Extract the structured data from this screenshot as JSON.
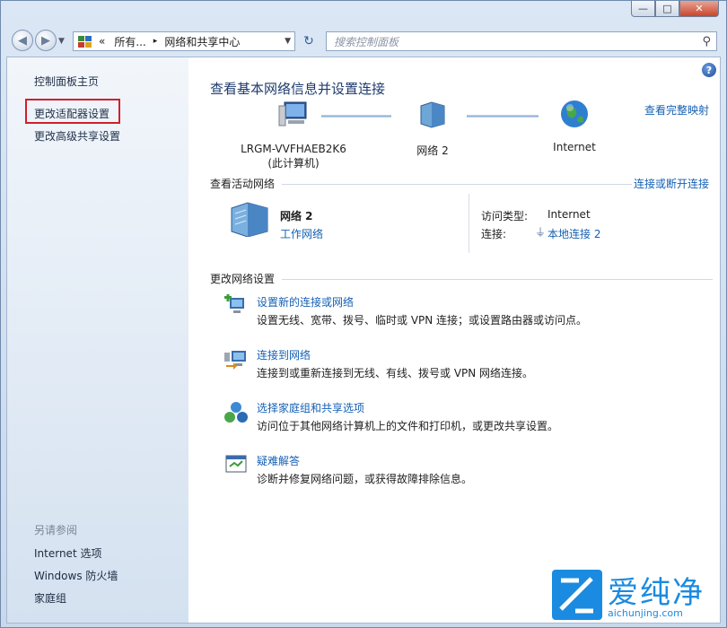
{
  "window": {
    "minimize": "—",
    "maximize": "□",
    "close": "✕"
  },
  "address_bar": {
    "chevron": "«",
    "crumb_1": "所有...",
    "separator": "▸",
    "crumb_2": "网络和共享中心",
    "search_placeholder": "搜索控制面板"
  },
  "sidebar": {
    "home": "控制面板主页",
    "adapter": "更改适配器设置",
    "sharing": "更改高级共享设置",
    "see_also_heading": "另请参阅",
    "see_also": [
      "Internet 选项",
      "Windows 防火墙",
      "家庭组"
    ]
  },
  "main": {
    "title": "查看基本网络信息并设置连接",
    "full_map": "查看完整映射",
    "map_nodes": [
      {
        "name": "LRGM-VVFHAEB2K6",
        "sub": "(此计算机)"
      },
      {
        "name": "网络  2",
        "sub": ""
      },
      {
        "name": "Internet",
        "sub": ""
      }
    ],
    "active_heading": "查看活动网络",
    "connect_disconnect": "连接或断开连接",
    "network_name": "网络  2",
    "network_type": "工作网络",
    "access_type_label": "访问类型:",
    "access_type_value": "Internet",
    "connections_label": "连接:",
    "connections_value": "本地连接 2",
    "change_heading": "更改网络设置",
    "tasks": [
      {
        "icon": "new-connection-icon",
        "title": "设置新的连接或网络",
        "desc": "设置无线、宽带、拨号、临时或 VPN 连接；或设置路由器或访问点。"
      },
      {
        "icon": "connect-to-network-icon",
        "title": "连接到网络",
        "desc": "连接到或重新连接到无线、有线、拨号或 VPN 网络连接。"
      },
      {
        "icon": "homegroup-icon",
        "title": "选择家庭组和共享选项",
        "desc": "访问位于其他网络计算机上的文件和打印机，或更改共享设置。"
      },
      {
        "icon": "troubleshoot-icon",
        "title": "疑难解答",
        "desc": "诊断并修复网络问题，或获得故障排除信息。"
      }
    ]
  },
  "watermark": {
    "text": "爱纯净",
    "url": "aichunjing.com"
  }
}
